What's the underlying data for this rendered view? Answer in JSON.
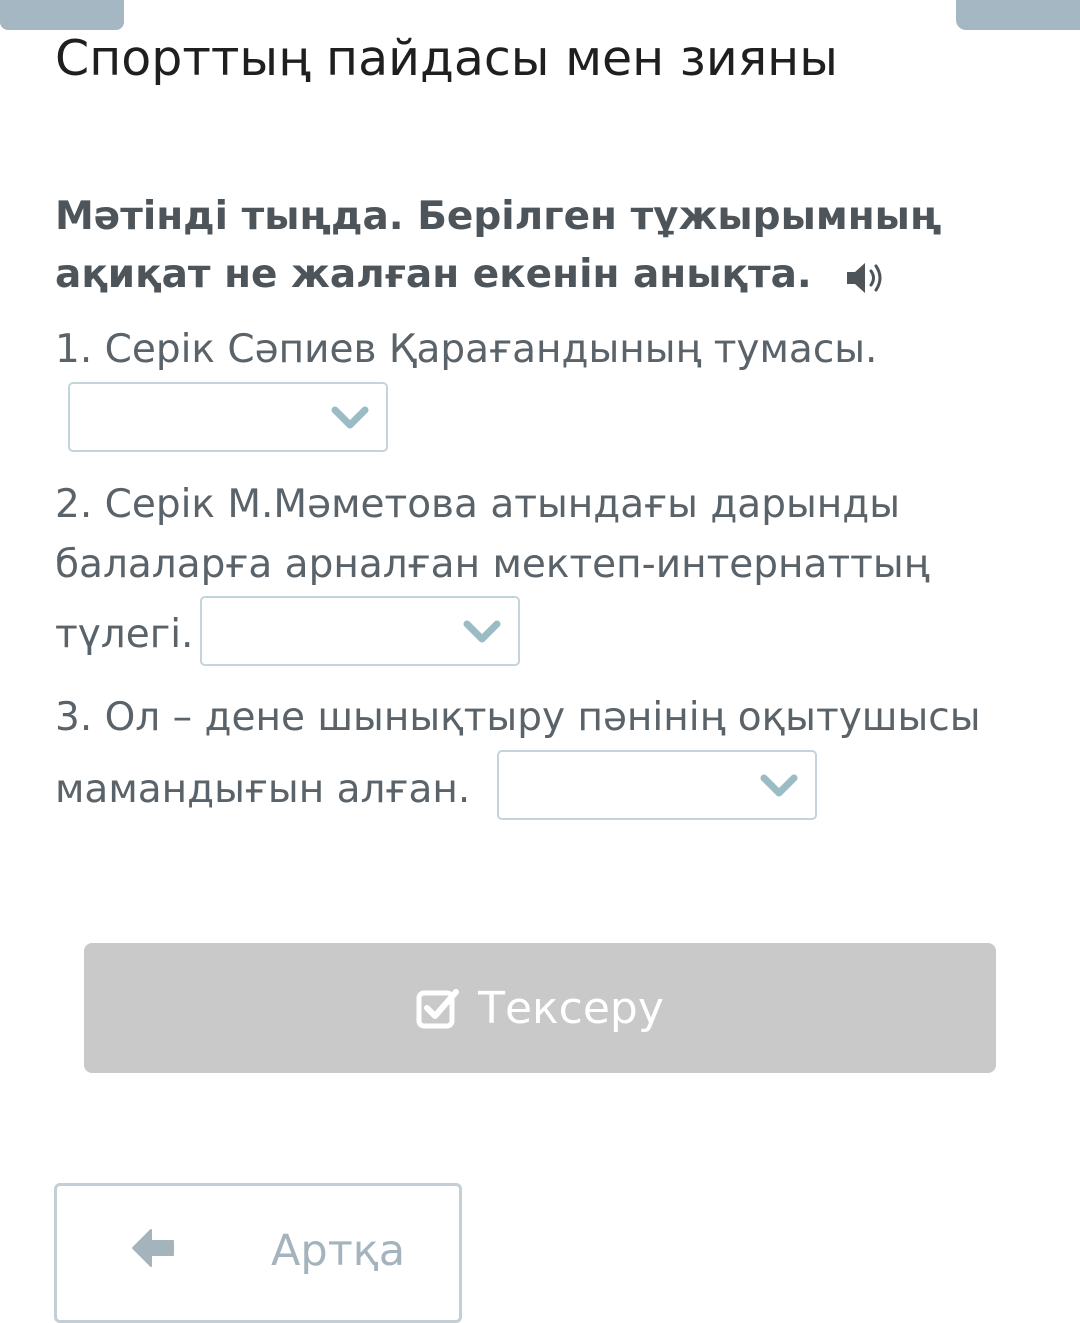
{
  "page": {
    "title": "Спорттың пайдасы мен зияны"
  },
  "exercise": {
    "instruction": "Мәтінді тыңда. Берілген тұжырымның ақиқат не жалған екенін анықта.",
    "questions": [
      {
        "line1": "1. Серік Сәпиев Қарағандының тумасы.",
        "selected": ""
      },
      {
        "line1": "2. Серік М.Мәметова атындағы дарынды",
        "line2": "балаларға арналған мектеп-интернаттың",
        "line3": "түлегі.",
        "selected": ""
      },
      {
        "line1": "3. Ол – дене шынықтыру пәнінің оқытушысы",
        "line2": "мамандығын алған.",
        "selected": ""
      }
    ]
  },
  "buttons": {
    "check_label": "Тексеру",
    "back_label": "Артқа"
  },
  "icons": {
    "speaker": "speaker-icon",
    "chevron": "chevron-down-icon",
    "check": "checkbox-check-icon",
    "back": "arrow-left-icon"
  },
  "colors": {
    "check_button_bg": "#c9c9c9",
    "dropdown_border": "#c3d4da",
    "chevron": "#9bbcc4",
    "tab": "#a5b7c2"
  }
}
